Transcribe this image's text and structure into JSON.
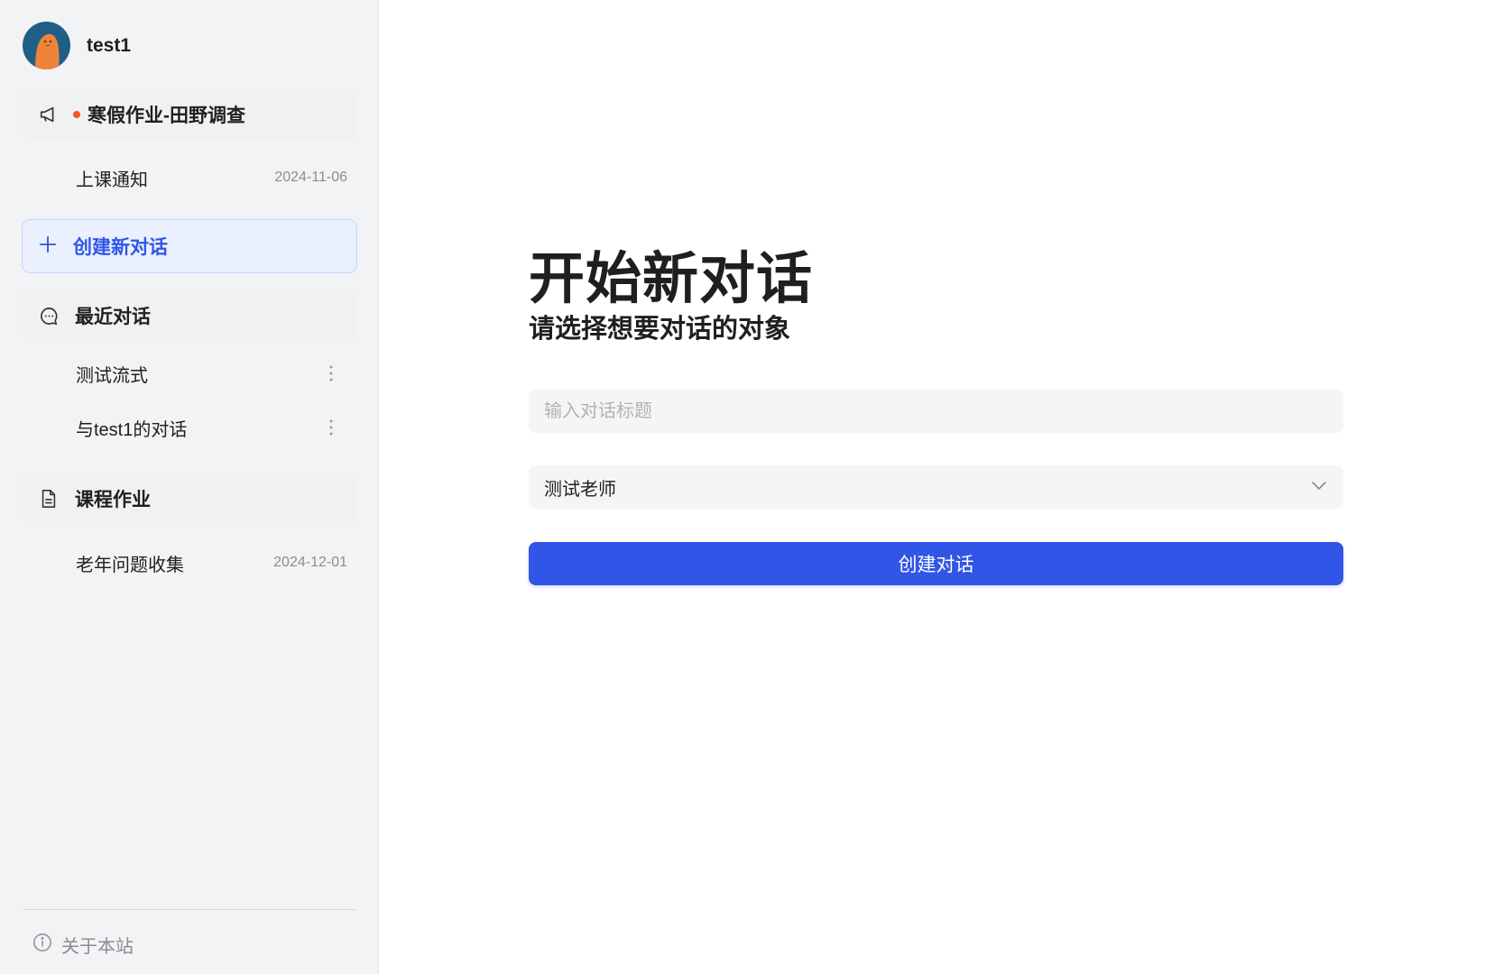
{
  "user": {
    "name": "test1",
    "avatar_icon": "avatar-character"
  },
  "sidebar": {
    "announcement": {
      "icon": "megaphone-icon",
      "label": "寒假作业-田野调查",
      "unread": true
    },
    "notices": [
      {
        "text": "上课通知",
        "date": "2024-11-06"
      }
    ],
    "create_button": {
      "icon": "plus-icon",
      "label": "创建新对话"
    },
    "recent": {
      "icon": "chat-bubble-icon",
      "label": "最近对话",
      "items": [
        {
          "text": "测试流式",
          "icon": "more-vertical-icon"
        },
        {
          "text": "与test1的对话",
          "icon": "more-vertical-icon"
        }
      ]
    },
    "homework": {
      "icon": "document-icon",
      "label": "课程作业",
      "items": [
        {
          "text": "老年问题收集",
          "date": "2024-12-01"
        }
      ]
    },
    "footer": {
      "icon": "info-icon",
      "label": "关于本站"
    }
  },
  "main": {
    "title": "开始新对话",
    "subtitle": "请选择想要对话的对象",
    "title_input": {
      "placeholder": "输入对话标题",
      "value": ""
    },
    "target_select": {
      "value": "测试老师",
      "icon": "chevron-down-icon"
    },
    "submit_label": "创建对话"
  },
  "colors": {
    "accent": "#3155e6",
    "sidebar_bg": "#f2f3f5",
    "unread_dot": "#f0591f"
  }
}
